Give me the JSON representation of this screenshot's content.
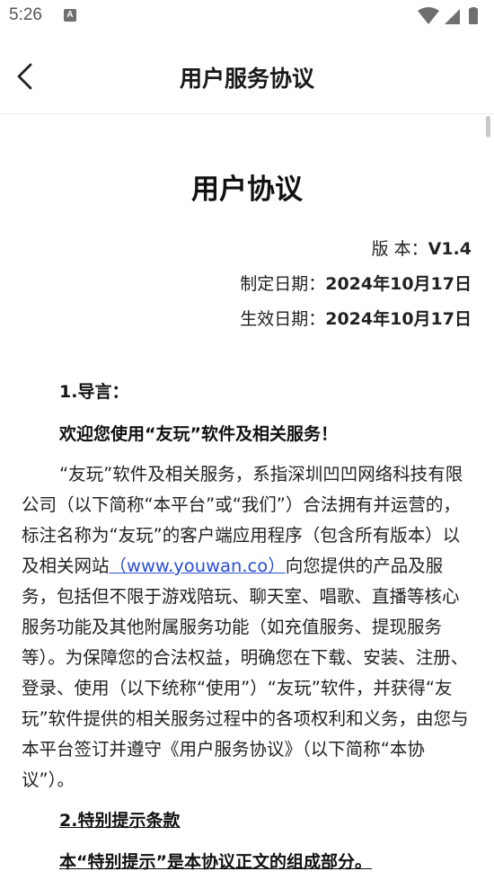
{
  "status_bar": {
    "time": "5:26",
    "notification_icon": "a-icon",
    "notification_glyph": "A",
    "icons": [
      "wifi-icon",
      "signal-icon",
      "battery-icon"
    ]
  },
  "header": {
    "title": "用户服务协议",
    "back_icon": "chevron-left-icon"
  },
  "document": {
    "title": "用户协议",
    "version_label": "版 本：",
    "version_value": "V1.4",
    "established_label": "制定日期：",
    "established_value": "2024年10月17日",
    "effective_label": "生效日期：",
    "effective_value": "2024年10月17日",
    "section1_heading": "1.导言：",
    "welcome": "欢迎您使用“友玩”软件及相关服务！",
    "para1_before_link": "“友玩”软件及相关服务，系指深圳凹凹网络科技有限公司（以下简称“本平台”或“我们”）合法拥有并运营的，标注名称为“友玩”的客户端应用程序（包含所有版本）以及相关网站",
    "para1_link": "（www.youwan.co）",
    "para1_after_link": "向您提供的产品及服务，包括但不限于游戏陪玩、聊天室、唱歌、直播等核心服务功能及其他附属服务功能（如充值服务、提现服务等）。为保障您的合法权益，明确您在下载、安装、注册、登录、使用（以下统称“使用”）“友玩”软件，并获得“友玩”软件提供的相关服务过程中的各项权利和义务，由您与本平台签订并遵守《用户服务协议》（以下简称“本协议”）。",
    "section2_heading": "2.特别提示条款",
    "section2_intro": "本“特别提示”是本协议正文的组成部分。"
  },
  "colors": {
    "link": "#2a4fd6",
    "text": "#222222",
    "divider": "#ececec"
  }
}
